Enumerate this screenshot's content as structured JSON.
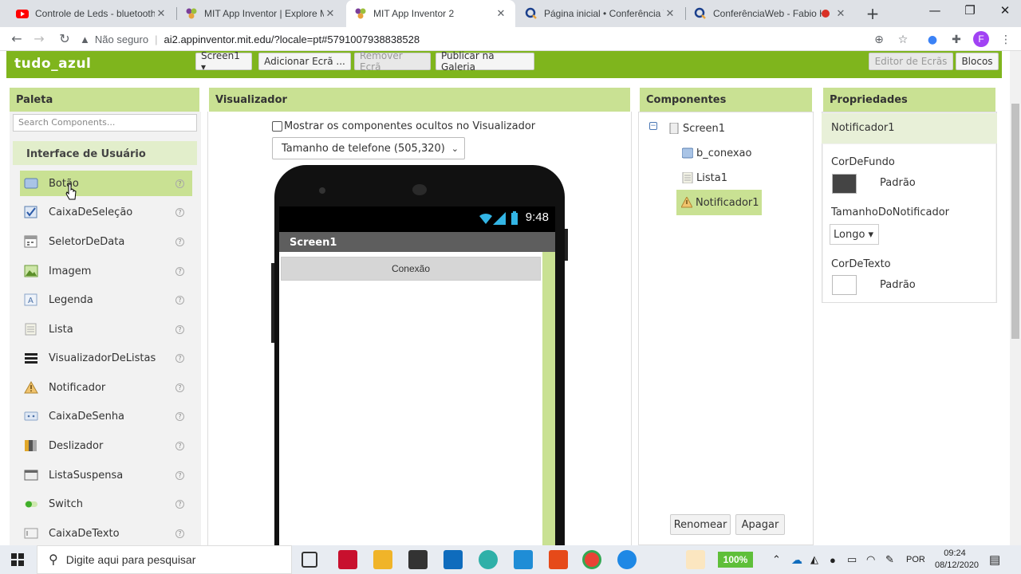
{
  "browser": {
    "tabs": [
      {
        "title": "Controle de Leds - bluetooth -",
        "icon": "youtube-icon",
        "color": "#ff0000"
      },
      {
        "title": "MIT App Inventor | Explore MI",
        "icon": "mit-app-inventor-icon",
        "color": "#7b3f99"
      },
      {
        "title": "MIT App Inventor 2",
        "icon": "mit-app-inventor-icon",
        "color": "#7b3f99"
      },
      {
        "title": "Página inicial • Conferência W",
        "icon": "conferenciaweb-icon",
        "color": "#1a3f8c"
      },
      {
        "title": "ConferênciaWeb - Fabio H",
        "icon": "conferenciaweb-icon",
        "color": "#1a3f8c"
      }
    ],
    "address": {
      "security_label": "Não seguro",
      "url": "ai2.appinventor.mit.edu/?locale=pt#5791007938838528"
    },
    "profile_initial": "F"
  },
  "app": {
    "project_name": "tudo_azul",
    "toolbar": {
      "screen_select": "Screen1 ▾",
      "add_screen": "Adicionar Ecrã ...",
      "remove_screen": "Remover Ecrã",
      "publish": "Publicar na Galeria",
      "designer": "Editor de Ecrãs",
      "blocks": "Blocos"
    },
    "accent_color": "#7fb51d"
  },
  "palette": {
    "title": "Paleta",
    "search_placeholder": "Search Components...",
    "category": "Interface de Usuário",
    "items": [
      {
        "label": "Botão",
        "icon": "button-icon"
      },
      {
        "label": "CaixaDeSeleção",
        "icon": "checkbox-icon"
      },
      {
        "label": "SeletorDeData",
        "icon": "date-picker-icon"
      },
      {
        "label": "Imagem",
        "icon": "image-icon"
      },
      {
        "label": "Legenda",
        "icon": "label-icon"
      },
      {
        "label": "Lista",
        "icon": "list-picker-icon"
      },
      {
        "label": "VisualizadorDeListas",
        "icon": "list-view-icon"
      },
      {
        "label": "Notificador",
        "icon": "notifier-icon"
      },
      {
        "label": "CaixaDeSenha",
        "icon": "password-icon"
      },
      {
        "label": "Deslizador",
        "icon": "slider-icon"
      },
      {
        "label": "ListaSuspensa",
        "icon": "spinner-icon"
      },
      {
        "label": "Switch",
        "icon": "switch-icon"
      },
      {
        "label": "CaixaDeTexto",
        "icon": "textbox-icon"
      }
    ],
    "help": "?"
  },
  "viewer": {
    "title": "Visualizador",
    "show_hidden_label": "Mostrar os componentes ocultos no Visualizador",
    "size_select": "Tamanho de telefone (505,320)",
    "phone": {
      "time": "9:48",
      "screen_title": "Screen1",
      "button_text": "Conexão"
    }
  },
  "components": {
    "title": "Componentes",
    "tree": [
      {
        "label": "Screen1",
        "icon": "screen-icon"
      },
      {
        "label": "b_conexao",
        "icon": "button-icon"
      },
      {
        "label": "Lista1",
        "icon": "list-picker-icon"
      },
      {
        "label": "Notificador1",
        "icon": "notifier-icon"
      }
    ],
    "rename": "Renomear",
    "delete": "Apagar"
  },
  "properties": {
    "title": "Propriedades",
    "component": "Notificador1",
    "bg_color_label": "CorDeFundo",
    "bg_color_value": "Padrão",
    "bg_color_swatch": "#444444",
    "size_label": "TamanhoDoNotificador",
    "size_value": "Longo ▾",
    "text_color_label": "CorDeTexto",
    "text_color_value": "Padrão",
    "text_color_swatch": "#ffffff"
  },
  "taskbar": {
    "search_placeholder": "Digite aqui para pesquisar",
    "battery": "100%",
    "language": "POR",
    "time": "09:24",
    "date": "08/12/2020"
  }
}
